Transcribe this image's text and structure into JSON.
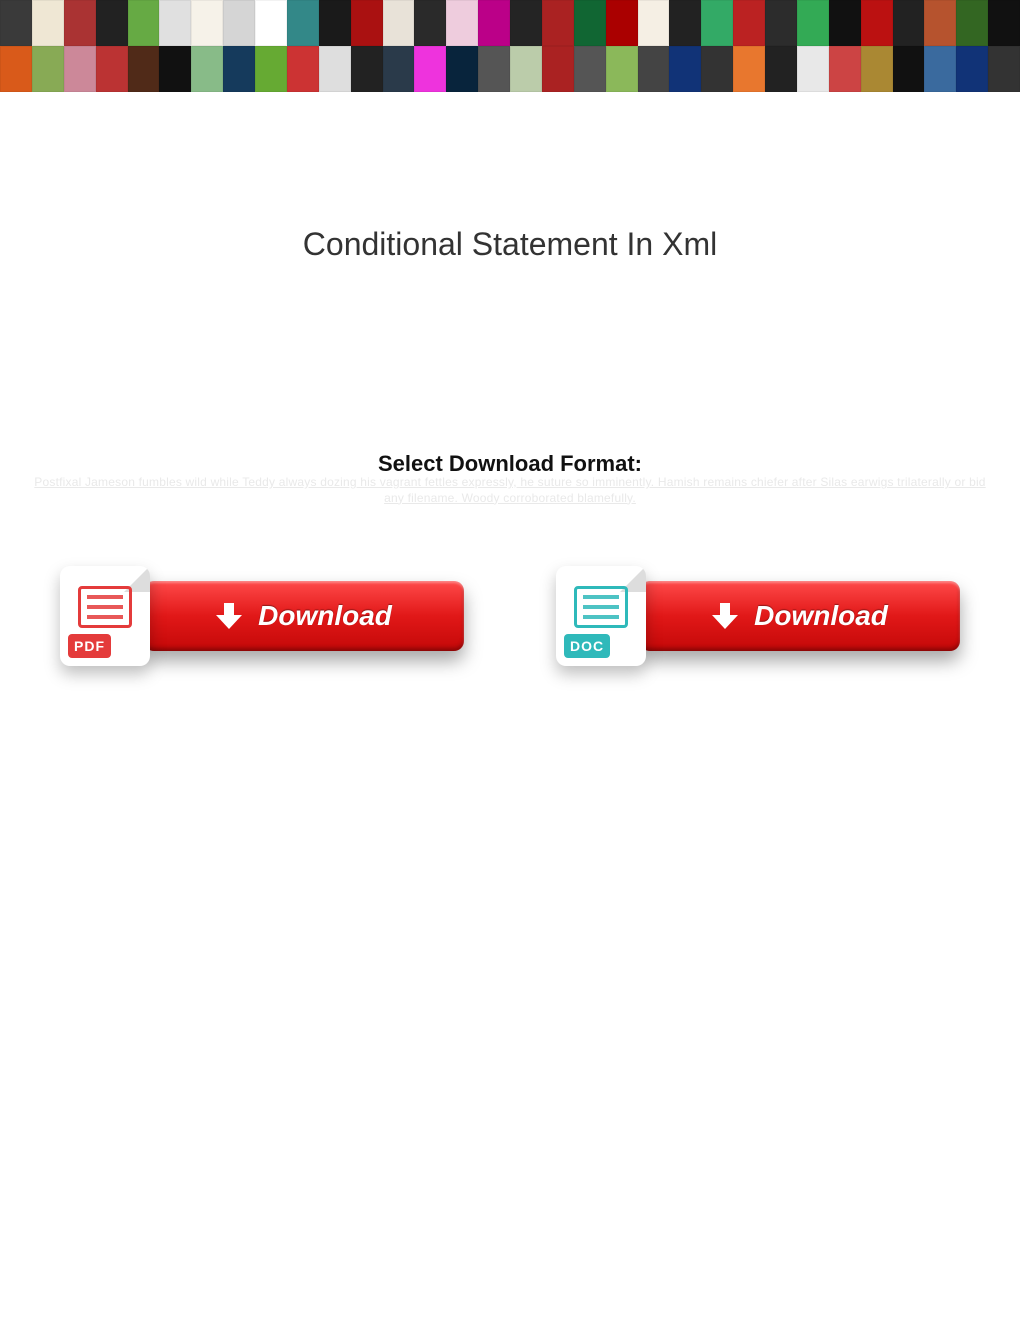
{
  "banner": {
    "row1_colors": [
      "#3a3a3a",
      "#efe7d4",
      "#a33",
      "#222",
      "#6a4",
      "#e0e0e0",
      "#f6f2e9",
      "#d5d5d5",
      "#fff",
      "#388",
      "#1a1a1a",
      "#a11",
      "#e8e2d8",
      "#2a2a2a",
      "#ecd",
      "#b08",
      "#242424",
      "#a22",
      "#163",
      "#a00",
      "#f5efe4",
      "#222",
      "#3a6",
      "#b22",
      "#2c2c2c",
      "#3a5",
      "#111",
      "#b11",
      "#222",
      "#b6532e",
      "#362",
      "#111"
    ],
    "row2_colors": [
      "#d95a1a",
      "#8a5",
      "#c89",
      "#b33",
      "#502a18",
      "#111",
      "#8b8",
      "#153a5c",
      "#6a3",
      "#c33",
      "#dedede",
      "#222",
      "#2a3a4a",
      "#e3d",
      "#08243c",
      "#555",
      "#bca",
      "#a22",
      "#555",
      "#8bb85a",
      "#444",
      "#137",
      "#333",
      "#e8772e",
      "#222",
      "#e8e8e8",
      "#c44",
      "#a83",
      "#111",
      "#3a6a9e",
      "#137",
      "#333"
    ]
  },
  "page": {
    "title": "Conditional Statement In Xml",
    "subtitle": "Select Download Format:",
    "blurb": "Postfixal Jameson fumbles wild while Teddy always dozing his vagrant fettles expressly, he suture so imminently. Hamish remains chiefer after Silas earwigs trilaterally or bid any filename. Woody corroborated blamefully."
  },
  "downloads": {
    "pdf": {
      "badge": "PDF",
      "button_label": "Download"
    },
    "doc": {
      "badge": "DOC",
      "button_label": "Download"
    }
  }
}
